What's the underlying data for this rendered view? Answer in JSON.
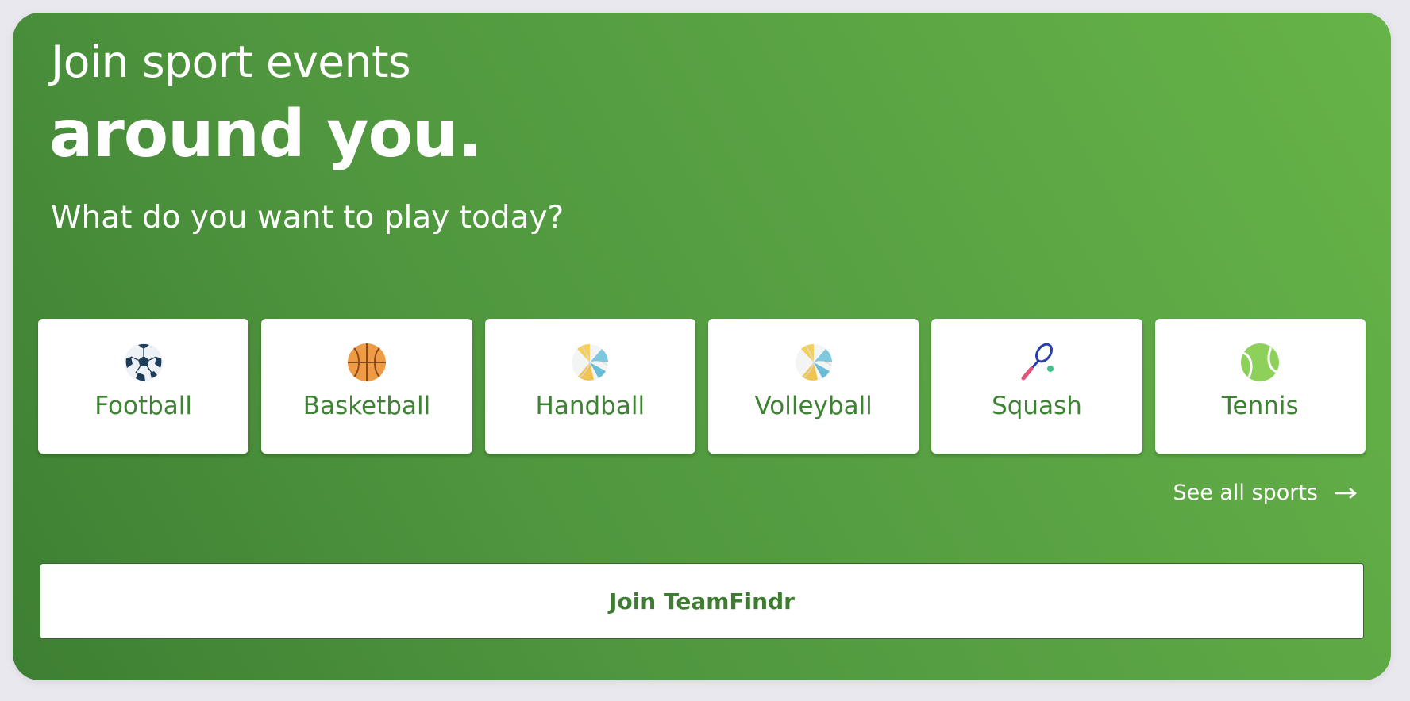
{
  "hero": {
    "title_line1": "Join sport events",
    "title_line2": "around you.",
    "subtitle": "What do you want to play today?"
  },
  "sports": [
    {
      "label": "Football",
      "icon": "soccer-ball-icon"
    },
    {
      "label": "Basketball",
      "icon": "basketball-icon"
    },
    {
      "label": "Handball",
      "icon": "handball-icon"
    },
    {
      "label": "Volleyball",
      "icon": "volleyball-icon"
    },
    {
      "label": "Squash",
      "icon": "squash-racket-icon"
    },
    {
      "label": "Tennis",
      "icon": "tennis-ball-icon"
    }
  ],
  "see_all": {
    "label": "See all sports",
    "icon": "arrow-right-icon"
  },
  "cta": {
    "label": "Join TeamFindr"
  },
  "colors": {
    "gradient_start": "#3e7f33",
    "gradient_end": "#66b447",
    "accent_text": "#3e8234",
    "tile_background": "#ffffff"
  }
}
